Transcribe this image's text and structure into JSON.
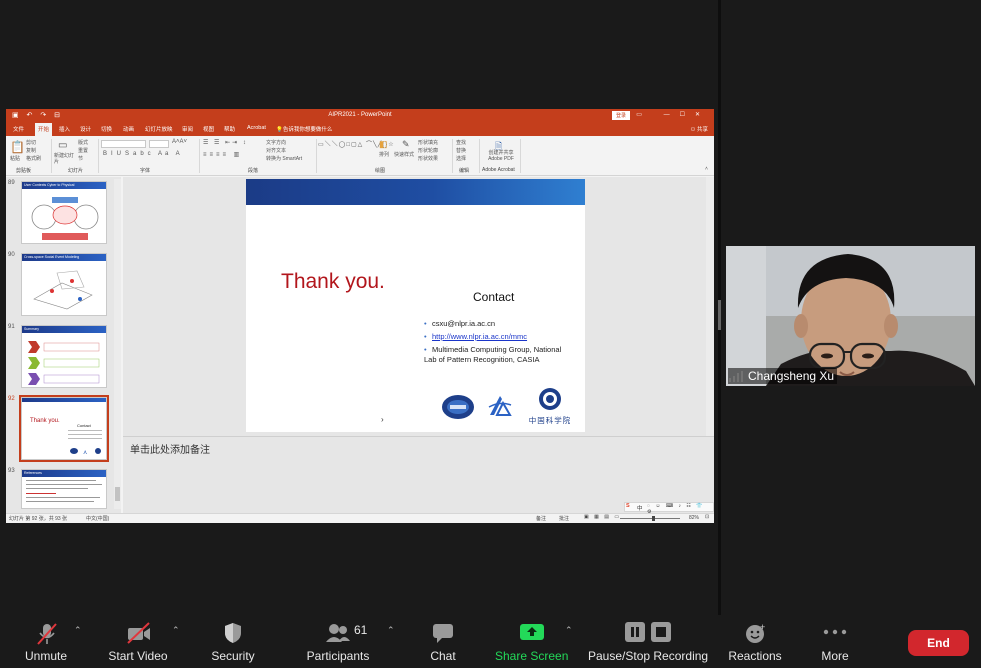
{
  "powerpoint": {
    "title": "AIPR2021 - PowerPoint",
    "login_label": "登录",
    "share_label": "共享",
    "tabs": [
      "文件",
      "开始",
      "插入",
      "设计",
      "切换",
      "动画",
      "幻灯片放映",
      "审阅",
      "视图",
      "帮助",
      "Acrobat",
      "告诉我你想要做什么"
    ],
    "ribbon": {
      "groups": [
        "剪贴板",
        "幻灯片",
        "字体",
        "段落",
        "绘图",
        "编辑",
        "Adobe Acrobat"
      ],
      "paste": "粘贴",
      "cut": "剪切",
      "copy": "复制",
      "format_painter": "格式刷",
      "new_slide": "新建幻灯片",
      "layout": "版式",
      "reset": "重置",
      "section": "节",
      "text_direction": "文字方向",
      "align_text": "对齐文本",
      "smartart": "转换为 SmartArt",
      "arrange": "排列",
      "quick_styles": "快速样式",
      "shape_fill": "形状填充",
      "shape_outline": "形状轮廓",
      "shape_effects": "形状效果",
      "find": "查找",
      "replace": "替换",
      "select": "选择",
      "acrobat": "创建并共享 Adobe PDF"
    },
    "thumbnails": [
      {
        "num": "89",
        "title": "User Contexts Cyber to Physical"
      },
      {
        "num": "90",
        "title": "Cross-space Social Event Modeling"
      },
      {
        "num": "91",
        "title": "Summary"
      },
      {
        "num": "92",
        "title": "Thank you."
      },
      {
        "num": "93",
        "title": "References"
      }
    ],
    "slide": {
      "thank_you": "Thank you.",
      "contact_heading": "Contact",
      "email": "csxu@nlpr.ia.ac.cn",
      "url": "http://www.nlpr.ia.ac.cn/mmc",
      "affiliation": "Multimedia Computing Group, National Lab of Pattern Recognition, CASIA",
      "logo_cas_text": "中国科学院"
    },
    "notes_placeholder": "单击此处添加备注",
    "status": {
      "slide_count": "幻灯片 第 92 张，共 93 张",
      "language": "中文(中国)",
      "notes_btn": "备注",
      "comments_btn": "批注",
      "zoom": "82%"
    },
    "ime_label": "中"
  },
  "participant": {
    "name": "Changsheng Xu"
  },
  "toolbar": {
    "unmute": "Unmute",
    "start_video": "Start Video",
    "security": "Security",
    "participants": "Participants",
    "participants_count": "61",
    "chat": "Chat",
    "share_screen": "Share Screen",
    "recording": "Pause/Stop Recording",
    "reactions": "Reactions",
    "more": "More",
    "end": "End"
  },
  "colors": {
    "ppt_accent": "#c43e1c",
    "zoom_end": "#d2272d",
    "share_green": "#23d959",
    "thank_red": "#b2161c"
  }
}
